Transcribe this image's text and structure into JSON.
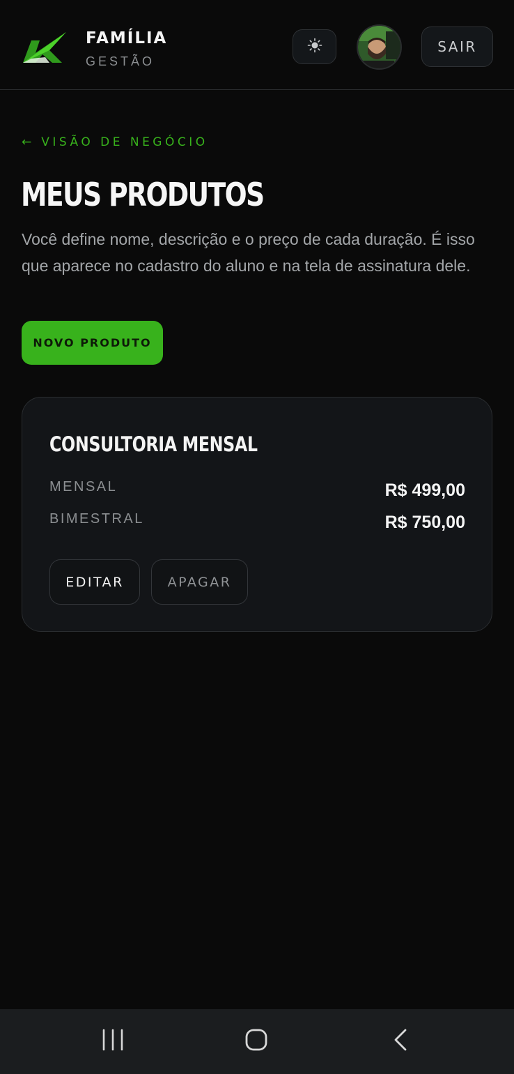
{
  "header": {
    "brand_title": "FAMÍLIA",
    "brand_subtitle": "GESTÃO",
    "logout_label": "SAIR"
  },
  "nav": {
    "back_arrow": "←",
    "back_label": "VISÃO DE NEGÓCIO"
  },
  "page": {
    "title": "MEUS PRODUTOS",
    "description": "Você define nome, descrição e o preço de cada duração. É isso que aparece no cadastro do aluno e na tela de assinatura dele.",
    "new_product_label": "NOVO PRODUTO"
  },
  "products": [
    {
      "name": "CONSULTORIA MENSAL",
      "prices": [
        {
          "label": "MENSAL",
          "value": "R$ 499,00"
        },
        {
          "label": "BIMESTRAL",
          "value": "R$ 750,00"
        }
      ],
      "edit_label": "EDITAR",
      "delete_label": "APAGAR"
    }
  ],
  "icons": {
    "logo": "k-logo-icon",
    "theme": "sun-icon",
    "nav_recent": "recent-apps-icon",
    "nav_home": "home-icon",
    "nav_back": "back-icon"
  },
  "colors": {
    "accent": "#38b21c",
    "background": "#0a0a0a",
    "card": "#131518"
  }
}
